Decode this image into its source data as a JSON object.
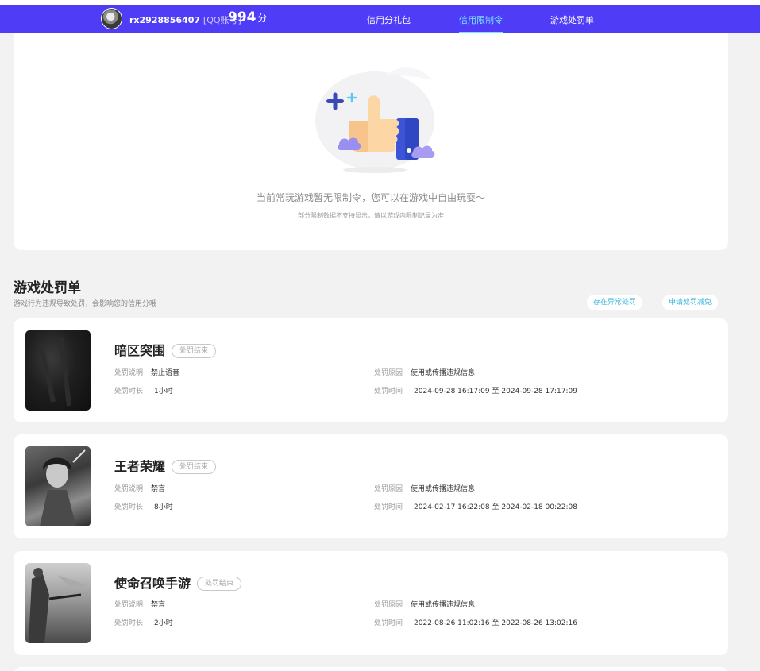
{
  "header": {
    "username": "rx2928856407",
    "account_type": "[QQ账号]",
    "score": "994",
    "score_unit": "分",
    "tabs": [
      {
        "label": "信用分礼包"
      },
      {
        "label": "信用限制令"
      },
      {
        "label": "游戏处罚单"
      }
    ],
    "active_tab": "信用限制令"
  },
  "restriction": {
    "empty_message": "当前常玩游戏暂无限制令，您可以在游戏中自由玩耍～",
    "note": "部分限制数据不支持显示，请以游戏内限制记录为准"
  },
  "penalty": {
    "title": "游戏处罚单",
    "subtitle": "游戏行为违规导致处罚，会影响您的信用分哦",
    "btn_abnormal": "存在异常处罚",
    "btn_reduce": "申请处罚减免",
    "label_desc": "处罚说明",
    "label_duration": "处罚时长",
    "label_reason": "处罚原因",
    "label_time": "处罚时间",
    "to": "至",
    "items": [
      {
        "game": "暗区突围",
        "status": "处罚结束",
        "desc": "禁止语音",
        "duration": "1小时",
        "reason": "使用或传播违规信息",
        "start": "2024-09-28 16:17:09",
        "end": "2024-09-28 17:17:09"
      },
      {
        "game": "王者荣耀",
        "status": "处罚结束",
        "desc": "禁言",
        "duration": "8小时",
        "reason": "使用或传播违规信息",
        "start": "2024-02-17 16:22:08",
        "end": "2024-02-18 00:22:08"
      },
      {
        "game": "使命召唤手游",
        "status": "处罚结束",
        "desc": "禁言",
        "duration": "2小时",
        "reason": "使用或传播违规信息",
        "start": "2022-08-26 11:02:16",
        "end": "2022-08-26 13:02:16"
      }
    ]
  },
  "colors": {
    "nav_bg": "#4f3cf6",
    "active_tab": "#7be3ff",
    "accent_link": "#3bb6de"
  }
}
